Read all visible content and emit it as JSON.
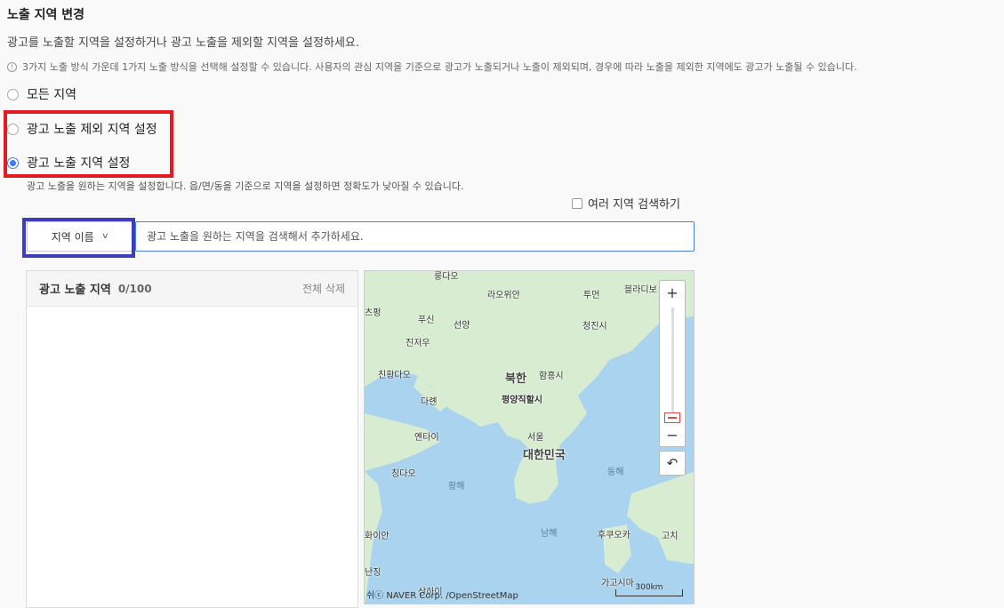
{
  "section": {
    "title": "노출 지역 변경",
    "description": "광고를 노출할 지역을 설정하거나 광고 노출을 제외할 지역을 설정하세요.",
    "notice": "3가지 노출 방식 가운데 1가지 노출 방식을 선택해 설정할 수 있습니다. 사용자의 관심 지역을 기준으로 광고가 노출되거나 노출이 제외되며, 경우에 따라 노출을 제외한 지역에도 광고가 노출될 수 있습니다."
  },
  "radio_options": [
    {
      "label": "모든 지역",
      "checked": false
    },
    {
      "label": "광고 노출 제외 지역 설정",
      "checked": false
    },
    {
      "label": "광고 노출 지역 설정",
      "checked": true
    }
  ],
  "selected_option_desc": "광고 노출을 원하는 지역을 설정합니다. 읍/면/동을 기준으로 지역을 설정하면 정확도가 낮아질 수 있습니다.",
  "multi_search": {
    "label": "여러 지역 검색하기",
    "checked": false
  },
  "search": {
    "dropdown_label": "지역 이름",
    "placeholder": "광고 노출을 원하는 지역을 검색해서 추가하세요."
  },
  "selected_panel": {
    "title": "광고 노출 지역",
    "count": "0/100",
    "clear_label": "전체 삭제"
  },
  "map": {
    "labels": {
      "ulaanbaatar": "라오위안",
      "tumen": "투먼",
      "vladivostok": "블라디보",
      "chifeng": "츠펑",
      "fuxin": "푸신",
      "shenyang": "선양",
      "chongjin": "청진시",
      "jinzhou": "진저우",
      "qinhuangdao": "친황다오",
      "north_korea": "북한",
      "hamhung": "함흥시",
      "pyongyang": "평양직할시",
      "dalian": "다롄",
      "yantai": "옌타이",
      "seoul": "서울",
      "south_korea": "대한민국",
      "qingdao": "칭다오",
      "yellow_sea": "황해",
      "east_sea": "동해",
      "south_sea": "남해",
      "huaian": "화이안",
      "fukuoka": "후쿠오카",
      "kochi": "고치",
      "nanjing": "난징",
      "shanghai": "상하이",
      "kagoshima": "가고시마",
      "top_city": "룽다오"
    },
    "zoom_in": "+",
    "zoom_out": "−",
    "reset": "↶",
    "attribution": "쉬ⓒ NAVER Corp. /OpenStreetMap",
    "scale": "300km"
  },
  "colors": {
    "accent": "#3d7cf0",
    "highlight_red": "#e21b23",
    "highlight_blue": "#3e3ebd",
    "land": "#d7ecd0",
    "sea": "#a9d3ee"
  }
}
